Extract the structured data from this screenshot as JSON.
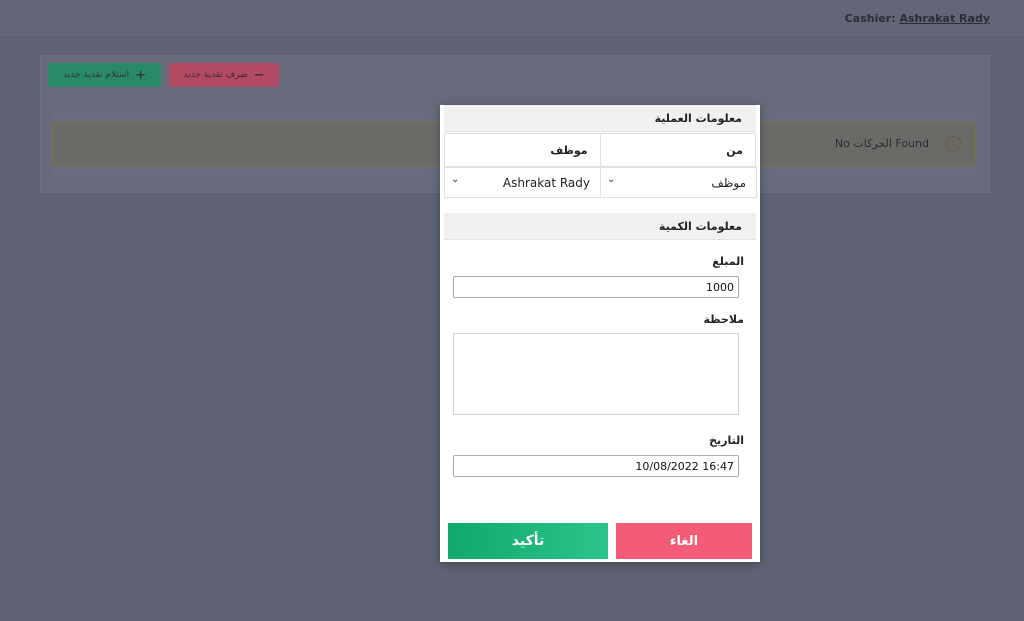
{
  "header": {
    "cashier_label": "Cashier:",
    "cashier_name": "Ashrakat Rady"
  },
  "toolbar": {
    "receive_label": "استلام نقدية جديد",
    "receive_symbol": "+",
    "spend_label": "صرف نقدية جديد",
    "spend_symbol": "−"
  },
  "alert": {
    "text": "No الحركات Found",
    "icon": "info-circle-icon"
  },
  "modal": {
    "operation_section_title": "معلومات العملية",
    "from_header": "من",
    "to_header": "موظف",
    "from_select_value": "موظف",
    "to_select_value": "Ashrakat Rady",
    "quantity_section_title": "معلومات الكمية",
    "amount_label": "المبلغ",
    "amount_value": "1000",
    "note_label": "ملاحظة",
    "note_value": "",
    "date_label": "التاريخ",
    "date_value": "10/08/2022 16:47",
    "cancel_label": "الغاء",
    "confirm_label": "تأكيد"
  },
  "colors": {
    "cancel": "#f35b77",
    "confirm": "#11a86a"
  }
}
